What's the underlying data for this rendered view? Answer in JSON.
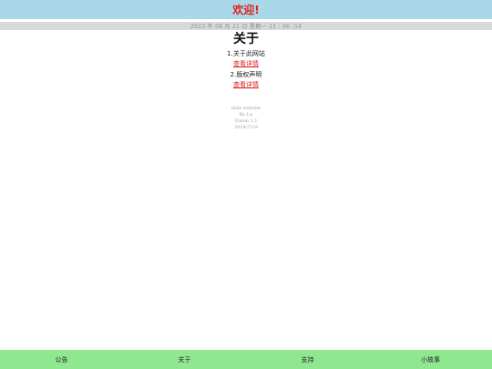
{
  "header": {
    "title": "欢迎!"
  },
  "datebar": {
    "text": "2023 年 08 月 21 日 星期一 21 : 06 :54"
  },
  "main": {
    "title": "关于",
    "sections": [
      {
        "heading": "1.关于此网站",
        "link": "查看详情"
      },
      {
        "heading": "2.版权声明",
        "link": "查看详情"
      }
    ]
  },
  "info": {
    "lines": [
      "elsis website",
      "By Lu",
      "Vision 1.1",
      "2024/7/19"
    ]
  },
  "nav": {
    "items": [
      "公告",
      "关于",
      "支持",
      "小故事"
    ]
  },
  "colors": {
    "banner": "#a9d8e8",
    "accent": "#e02020",
    "nav": "#8fe88f",
    "datebar": "#d9d9d9"
  }
}
